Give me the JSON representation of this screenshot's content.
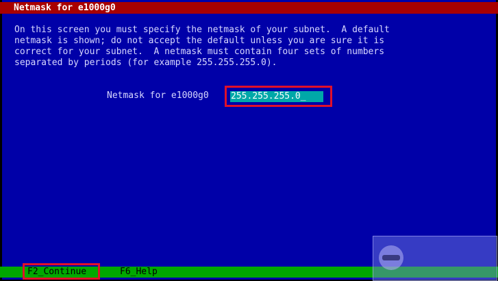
{
  "window": {
    "title": "Netmask for e1000g0"
  },
  "instructions": {
    "lines": [
      "On this screen you must specify the netmask of your subnet.  A default",
      "netmask is shown; do not accept the default unless you are sure it is",
      "correct for your subnet.  A netmask must contain four sets of numbers",
      "separated by periods (for example 255.255.255.0)."
    ]
  },
  "netmask_field": {
    "label": "Netmask for e1000g0",
    "value": "255.255.255.0",
    "cursor": "_"
  },
  "function_keys": {
    "continue": "F2_Continue",
    "help": "F6_Help"
  },
  "colors": {
    "background": "#0000a8",
    "title_bar": "#a80000",
    "input_field": "#00a8a8",
    "function_key_bar": "#00a800",
    "highlight_box": "#e0102a"
  },
  "icons": [
    "watermark-logo-icon"
  ]
}
